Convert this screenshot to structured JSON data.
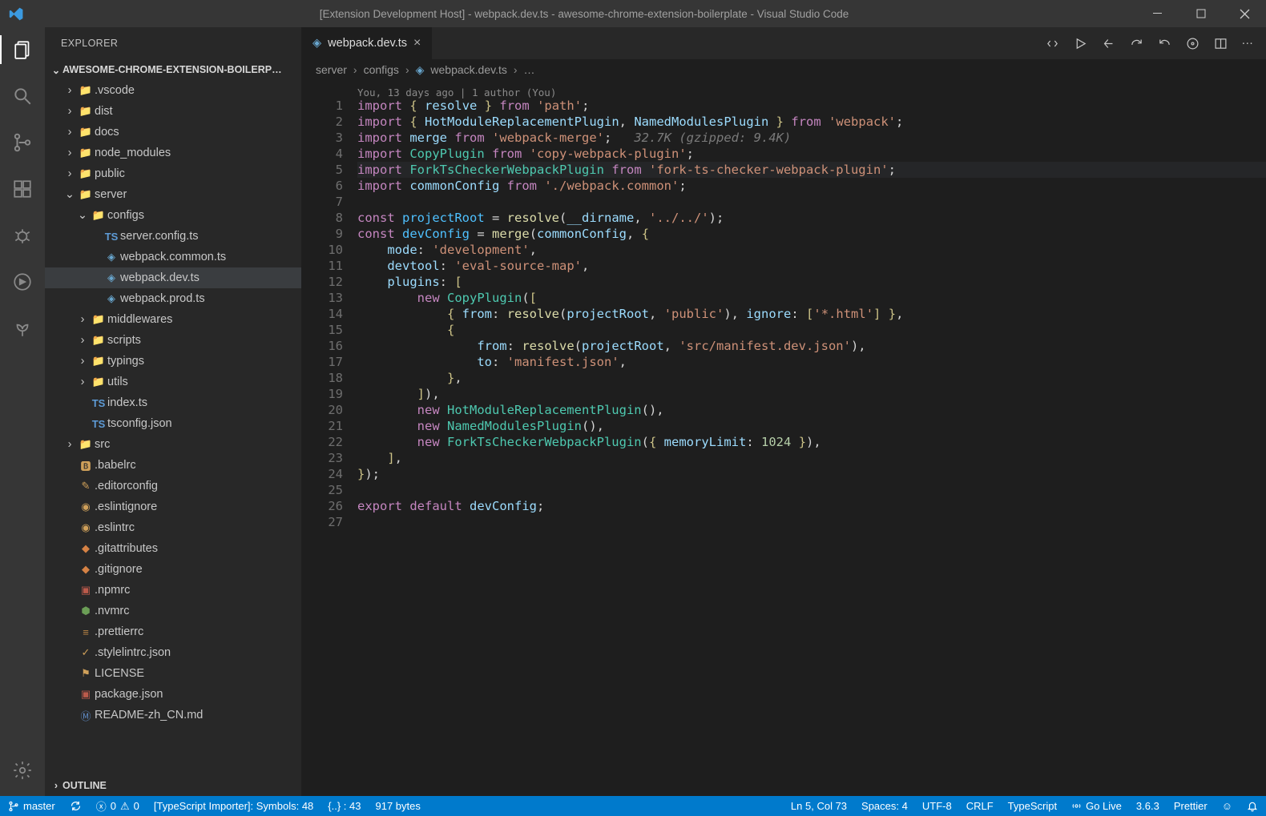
{
  "title": "[Extension Development Host] - webpack.dev.ts - awesome-chrome-extension-boilerplate - Visual Studio Code",
  "sidebar": {
    "header": "EXPLORER",
    "workspace": "AWESOME-CHROME-EXTENSION-BOILERP…",
    "outline": "OUTLINE",
    "tree": [
      {
        "d": 1,
        "t": "folder",
        "c": true,
        "n": ".vscode",
        "ic": "folder"
      },
      {
        "d": 1,
        "t": "folder",
        "c": true,
        "n": "dist",
        "ic": "folder-y"
      },
      {
        "d": 1,
        "t": "folder",
        "c": true,
        "n": "docs",
        "ic": "folder"
      },
      {
        "d": 1,
        "t": "folder",
        "c": true,
        "n": "node_modules",
        "ic": "folder-g"
      },
      {
        "d": 1,
        "t": "folder",
        "c": true,
        "n": "public",
        "ic": "folder-g"
      },
      {
        "d": 1,
        "t": "folder",
        "c": false,
        "n": "server",
        "ic": "folder-g"
      },
      {
        "d": 2,
        "t": "folder",
        "c": false,
        "n": "configs",
        "ic": "folder-g"
      },
      {
        "d": 3,
        "t": "file",
        "n": "server.config.ts",
        "ic": "ts"
      },
      {
        "d": 3,
        "t": "file",
        "n": "webpack.common.ts",
        "ic": "wp"
      },
      {
        "d": 3,
        "t": "file",
        "n": "webpack.dev.ts",
        "ic": "wp",
        "sel": true
      },
      {
        "d": 3,
        "t": "file",
        "n": "webpack.prod.ts",
        "ic": "wp"
      },
      {
        "d": 2,
        "t": "folder",
        "c": true,
        "n": "middlewares",
        "ic": "folder"
      },
      {
        "d": 2,
        "t": "folder",
        "c": true,
        "n": "scripts",
        "ic": "folder"
      },
      {
        "d": 2,
        "t": "folder",
        "c": true,
        "n": "typings",
        "ic": "folder-t"
      },
      {
        "d": 2,
        "t": "folder",
        "c": true,
        "n": "utils",
        "ic": "folder-g"
      },
      {
        "d": 2,
        "t": "file",
        "n": "index.ts",
        "ic": "ts"
      },
      {
        "d": 2,
        "t": "file",
        "n": "tsconfig.json",
        "ic": "tscfg"
      },
      {
        "d": 1,
        "t": "folder",
        "c": true,
        "n": "src",
        "ic": "folder-g",
        "dirty": true
      },
      {
        "d": 1,
        "t": "file",
        "n": ".babelrc",
        "ic": "babel"
      },
      {
        "d": 1,
        "t": "file",
        "n": ".editorconfig",
        "ic": "edit"
      },
      {
        "d": 1,
        "t": "file",
        "n": ".eslintignore",
        "ic": "eslint"
      },
      {
        "d": 1,
        "t": "file",
        "n": ".eslintrc",
        "ic": "eslint"
      },
      {
        "d": 1,
        "t": "file",
        "n": ".gitattributes",
        "ic": "git"
      },
      {
        "d": 1,
        "t": "file",
        "n": ".gitignore",
        "ic": "git"
      },
      {
        "d": 1,
        "t": "file",
        "n": ".npmrc",
        "ic": "npm"
      },
      {
        "d": 1,
        "t": "file",
        "n": ".nvmrc",
        "ic": "node"
      },
      {
        "d": 1,
        "t": "file",
        "n": ".prettierrc",
        "ic": "pret"
      },
      {
        "d": 1,
        "t": "file",
        "n": ".stylelintrc.json",
        "ic": "style"
      },
      {
        "d": 1,
        "t": "file",
        "n": "LICENSE",
        "ic": "lic"
      },
      {
        "d": 1,
        "t": "file",
        "n": "package.json",
        "ic": "npm"
      },
      {
        "d": 1,
        "t": "file",
        "n": "README-zh_CN.md",
        "ic": "md"
      }
    ]
  },
  "tabs": [
    {
      "name": "webpack.dev.ts",
      "icon": "wp"
    }
  ],
  "breadcrumbs": [
    "server",
    "configs",
    "webpack.dev.ts",
    "…"
  ],
  "codelens": "You, 13 days ago | 1 author (You)",
  "code": [
    {
      "no": 1,
      "seg": [
        [
          "kw",
          "import"
        ],
        [
          "pn",
          " "
        ],
        [
          "br",
          "{"
        ],
        [
          "pn",
          " "
        ],
        [
          "var",
          "resolve"
        ],
        [
          "pn",
          " "
        ],
        [
          "br",
          "}"
        ],
        [
          "pn",
          " "
        ],
        [
          "kw",
          "from"
        ],
        [
          "pn",
          " "
        ],
        [
          "str",
          "'path'"
        ],
        [
          "pn",
          ";"
        ]
      ]
    },
    {
      "no": 2,
      "seg": [
        [
          "kw",
          "import"
        ],
        [
          "pn",
          " "
        ],
        [
          "br",
          "{"
        ],
        [
          "pn",
          " "
        ],
        [
          "var",
          "HotModuleReplacementPlugin"
        ],
        [
          "pn",
          ", "
        ],
        [
          "var",
          "NamedModulesPlugin"
        ],
        [
          "pn",
          " "
        ],
        [
          "br",
          "}"
        ],
        [
          "pn",
          " "
        ],
        [
          "kw",
          "from"
        ],
        [
          "pn",
          " "
        ],
        [
          "str",
          "'webpack'"
        ],
        [
          "pn",
          ";"
        ]
      ]
    },
    {
      "no": 3,
      "seg": [
        [
          "kw",
          "import"
        ],
        [
          "pn",
          " "
        ],
        [
          "var",
          "merge"
        ],
        [
          "pn",
          " "
        ],
        [
          "kw",
          "from"
        ],
        [
          "pn",
          " "
        ],
        [
          "str",
          "'webpack-merge'"
        ],
        [
          "pn",
          ";   "
        ],
        [
          "hint",
          "32.7K (gzipped: 9.4K)"
        ]
      ]
    },
    {
      "no": 4,
      "seg": [
        [
          "kw",
          "import"
        ],
        [
          "pn",
          " "
        ],
        [
          "ty",
          "CopyPlugin"
        ],
        [
          "pn",
          " "
        ],
        [
          "kw",
          "from"
        ],
        [
          "pn",
          " "
        ],
        [
          "str",
          "'copy-webpack-plugin'"
        ],
        [
          "pn",
          ";"
        ]
      ]
    },
    {
      "no": 5,
      "cur": true,
      "seg": [
        [
          "kw",
          "import"
        ],
        [
          "pn",
          " "
        ],
        [
          "ty",
          "ForkTsCheckerWebpackPlugin"
        ],
        [
          "pn",
          " "
        ],
        [
          "kw",
          "from"
        ],
        [
          "pn",
          " "
        ],
        [
          "str",
          "'fork-ts-checker-webpack-plugin'"
        ],
        [
          "pn",
          ";"
        ]
      ]
    },
    {
      "no": 6,
      "seg": [
        [
          "kw",
          "import"
        ],
        [
          "pn",
          " "
        ],
        [
          "var",
          "commonConfig"
        ],
        [
          "pn",
          " "
        ],
        [
          "kw",
          "from"
        ],
        [
          "pn",
          " "
        ],
        [
          "str",
          "'./webpack.common'"
        ],
        [
          "pn",
          ";"
        ]
      ]
    },
    {
      "no": 7,
      "seg": []
    },
    {
      "no": 8,
      "seg": [
        [
          "kw",
          "const"
        ],
        [
          "pn",
          " "
        ],
        [
          "const",
          "projectRoot"
        ],
        [
          "pn",
          " = "
        ],
        [
          "fn",
          "resolve"
        ],
        [
          "pn",
          "("
        ],
        [
          "var",
          "__dirname"
        ],
        [
          "pn",
          ", "
        ],
        [
          "str",
          "'../../'"
        ],
        [
          "pn",
          ");"
        ]
      ]
    },
    {
      "no": 9,
      "seg": [
        [
          "kw",
          "const"
        ],
        [
          "pn",
          " "
        ],
        [
          "const",
          "devConfig"
        ],
        [
          "pn",
          " = "
        ],
        [
          "fn",
          "merge"
        ],
        [
          "pn",
          "("
        ],
        [
          "var",
          "commonConfig"
        ],
        [
          "pn",
          ", "
        ],
        [
          "br",
          "{"
        ]
      ]
    },
    {
      "no": 10,
      "seg": [
        [
          "pn",
          "    "
        ],
        [
          "var",
          "mode"
        ],
        [
          "pn",
          ":"
        ],
        [
          "pn",
          " "
        ],
        [
          "str",
          "'development'"
        ],
        [
          "pn",
          ","
        ]
      ]
    },
    {
      "no": 11,
      "seg": [
        [
          "pn",
          "    "
        ],
        [
          "var",
          "devtool"
        ],
        [
          "pn",
          ":"
        ],
        [
          "pn",
          " "
        ],
        [
          "str",
          "'eval-source-map'"
        ],
        [
          "pn",
          ","
        ]
      ]
    },
    {
      "no": 12,
      "seg": [
        [
          "pn",
          "    "
        ],
        [
          "var",
          "plugins"
        ],
        [
          "pn",
          ":"
        ],
        [
          "pn",
          " "
        ],
        [
          "br",
          "["
        ]
      ]
    },
    {
      "no": 13,
      "seg": [
        [
          "pn",
          "        "
        ],
        [
          "kw",
          "new"
        ],
        [
          "pn",
          " "
        ],
        [
          "ty",
          "CopyPlugin"
        ],
        [
          "pn",
          "("
        ],
        [
          "br",
          "["
        ]
      ]
    },
    {
      "no": 14,
      "seg": [
        [
          "pn",
          "            "
        ],
        [
          "br",
          "{"
        ],
        [
          "pn",
          " "
        ],
        [
          "var",
          "from"
        ],
        [
          "pn",
          ":"
        ],
        [
          "pn",
          " "
        ],
        [
          "fn",
          "resolve"
        ],
        [
          "pn",
          "("
        ],
        [
          "var",
          "projectRoot"
        ],
        [
          "pn",
          ", "
        ],
        [
          "str",
          "'public'"
        ],
        [
          "pn",
          "), "
        ],
        [
          "var",
          "ignore"
        ],
        [
          "pn",
          ":"
        ],
        [
          "pn",
          " "
        ],
        [
          "br",
          "["
        ],
        [
          "str",
          "'*.html'"
        ],
        [
          "br",
          "]"
        ],
        [
          "pn",
          " "
        ],
        [
          "br",
          "}"
        ],
        [
          "pn",
          ","
        ]
      ]
    },
    {
      "no": 15,
      "seg": [
        [
          "pn",
          "            "
        ],
        [
          "br",
          "{"
        ]
      ]
    },
    {
      "no": 16,
      "seg": [
        [
          "pn",
          "                "
        ],
        [
          "var",
          "from"
        ],
        [
          "pn",
          ":"
        ],
        [
          "pn",
          " "
        ],
        [
          "fn",
          "resolve"
        ],
        [
          "pn",
          "("
        ],
        [
          "var",
          "projectRoot"
        ],
        [
          "pn",
          ", "
        ],
        [
          "str",
          "'src/manifest.dev.json'"
        ],
        [
          "pn",
          "),"
        ]
      ]
    },
    {
      "no": 17,
      "seg": [
        [
          "pn",
          "                "
        ],
        [
          "var",
          "to"
        ],
        [
          "pn",
          ":"
        ],
        [
          "pn",
          " "
        ],
        [
          "str",
          "'manifest.json'"
        ],
        [
          "pn",
          ","
        ]
      ]
    },
    {
      "no": 18,
      "seg": [
        [
          "pn",
          "            "
        ],
        [
          "br",
          "}"
        ],
        [
          "pn",
          ","
        ]
      ]
    },
    {
      "no": 19,
      "seg": [
        [
          "pn",
          "        "
        ],
        [
          "br",
          "]"
        ],
        [
          "pn",
          "),"
        ]
      ]
    },
    {
      "no": 20,
      "seg": [
        [
          "pn",
          "        "
        ],
        [
          "kw",
          "new"
        ],
        [
          "pn",
          " "
        ],
        [
          "ty",
          "HotModuleReplacementPlugin"
        ],
        [
          "pn",
          "(),"
        ]
      ]
    },
    {
      "no": 21,
      "seg": [
        [
          "pn",
          "        "
        ],
        [
          "kw",
          "new"
        ],
        [
          "pn",
          " "
        ],
        [
          "ty",
          "NamedModulesPlugin"
        ],
        [
          "pn",
          "(),"
        ]
      ]
    },
    {
      "no": 22,
      "seg": [
        [
          "pn",
          "        "
        ],
        [
          "kw",
          "new"
        ],
        [
          "pn",
          " "
        ],
        [
          "ty",
          "ForkTsCheckerWebpackPlugin"
        ],
        [
          "pn",
          "("
        ],
        [
          "br",
          "{"
        ],
        [
          "pn",
          " "
        ],
        [
          "var",
          "memoryLimit"
        ],
        [
          "pn",
          ":"
        ],
        [
          "pn",
          " "
        ],
        [
          "num",
          "1024"
        ],
        [
          "pn",
          " "
        ],
        [
          "br",
          "}"
        ],
        [
          "pn",
          "),"
        ]
      ]
    },
    {
      "no": 23,
      "seg": [
        [
          "pn",
          "    "
        ],
        [
          "br",
          "]"
        ],
        [
          "pn",
          ","
        ]
      ]
    },
    {
      "no": 24,
      "seg": [
        [
          "br",
          "}"
        ],
        [
          "pn",
          ");"
        ]
      ]
    },
    {
      "no": 25,
      "seg": []
    },
    {
      "no": 26,
      "seg": [
        [
          "kw",
          "export"
        ],
        [
          "pn",
          " "
        ],
        [
          "kw",
          "default"
        ],
        [
          "pn",
          " "
        ],
        [
          "var",
          "devConfig"
        ],
        [
          "pn",
          ";"
        ]
      ]
    },
    {
      "no": 27,
      "seg": []
    }
  ],
  "status": {
    "branch": "master",
    "errors": "0",
    "warns": "0",
    "importer": "[TypeScript Importer]: Symbols: 48",
    "braces": "{..} : 43",
    "size": "917 bytes",
    "pos": "Ln 5, Col 73",
    "spaces": "Spaces: 4",
    "enc": "UTF-8",
    "eol": "CRLF",
    "lang": "TypeScript",
    "golive": "Go Live",
    "ver": "3.6.3",
    "prettier": "Prettier"
  }
}
